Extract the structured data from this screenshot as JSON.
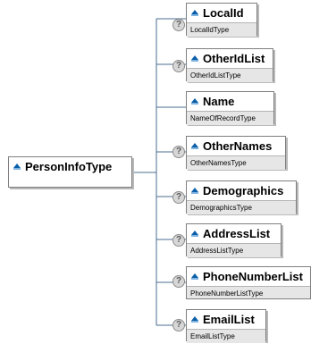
{
  "root": {
    "name": "PersonInfoType",
    "icon": "element-icon"
  },
  "children": [
    {
      "name": "LocalId",
      "type": "LocalIdType",
      "optional": true,
      "icon": "element-icon"
    },
    {
      "name": "OtherIdList",
      "type": "OtherIdListType",
      "optional": true,
      "icon": "element-icon"
    },
    {
      "name": "Name",
      "type": "NameOfRecordType",
      "optional": false,
      "icon": "element-icon"
    },
    {
      "name": "OtherNames",
      "type": "OtherNamesType",
      "optional": true,
      "icon": "element-icon"
    },
    {
      "name": "Demographics",
      "type": "DemographicsType",
      "optional": true,
      "icon": "element-icon"
    },
    {
      "name": "AddressList",
      "type": "AddressListType",
      "optional": true,
      "icon": "element-icon"
    },
    {
      "name": "PhoneNumberList",
      "type": "PhoneNumberListType",
      "optional": true,
      "icon": "element-icon"
    },
    {
      "name": "EmailList",
      "type": "EmailListType",
      "optional": true,
      "icon": "element-icon"
    }
  ],
  "optional_marker": "?",
  "colors": {
    "connector": "#4b6d91",
    "icon_fill": "#0b5fa8",
    "type_band": "#e6e6e6",
    "border": "#7f7f7f"
  }
}
